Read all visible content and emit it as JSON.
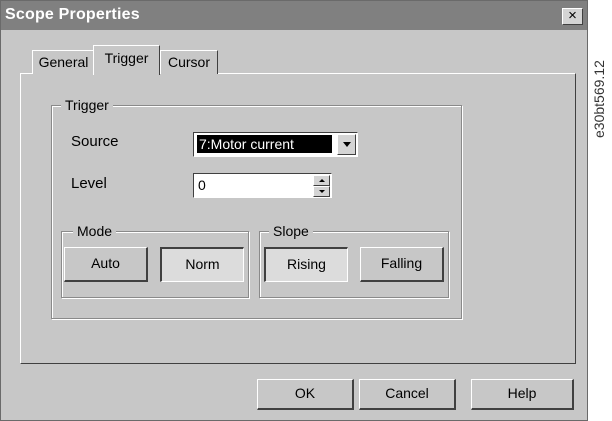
{
  "window": {
    "title": "Scope Properties",
    "close_label": "×"
  },
  "tabs": [
    {
      "label": "General"
    },
    {
      "label": "Trigger",
      "active": true
    },
    {
      "label": "Cursor"
    }
  ],
  "trigger_group": {
    "title": "Trigger",
    "source_label": "Source",
    "source_value": "7:Motor current",
    "level_label": "Level",
    "level_value": "0"
  },
  "mode_group": {
    "title": "Mode",
    "buttons": [
      "Auto",
      "Norm"
    ],
    "selected": "Norm"
  },
  "slope_group": {
    "title": "Slope",
    "buttons": [
      "Rising",
      "Falling"
    ],
    "selected": "Rising"
  },
  "footer": {
    "ok_label": "OK",
    "cancel_label": "Cancel",
    "help_label": "Help"
  },
  "side_code": "e30bt569.12",
  "colors": {
    "titlebar": "#808080",
    "dialog_bg": "#c7c7c7",
    "selection": "#000000"
  }
}
